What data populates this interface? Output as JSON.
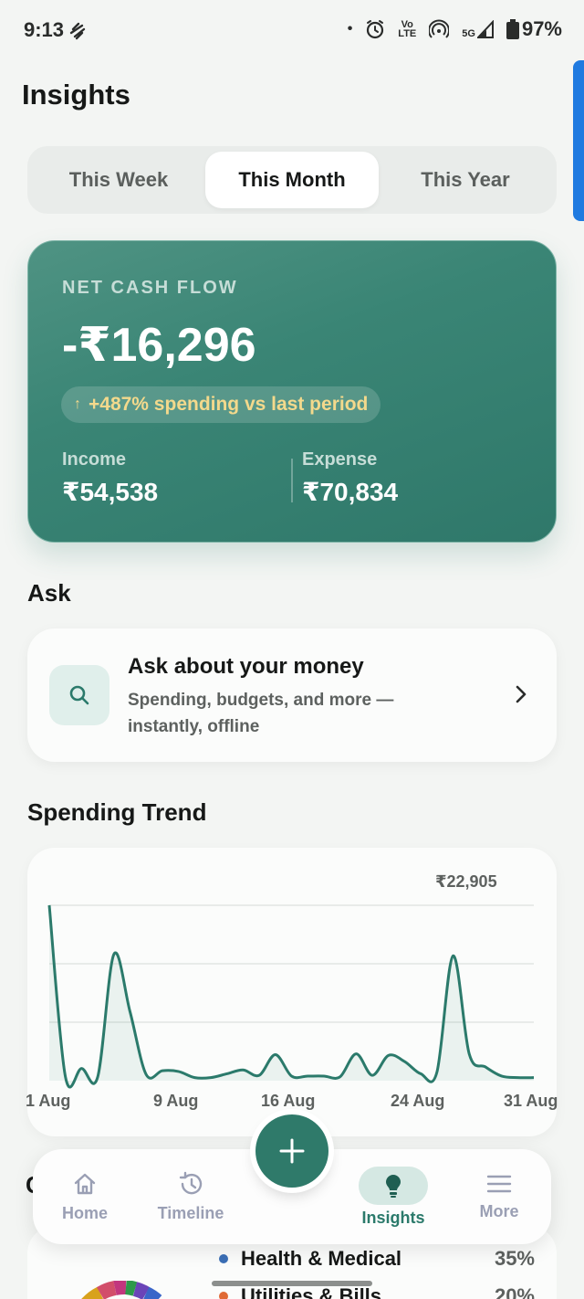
{
  "status_bar": {
    "time": "9:13",
    "lte_top": "Vo",
    "lte_bottom": "LTE",
    "network": "5G",
    "battery": "97%"
  },
  "page": {
    "title": "Insights"
  },
  "tabs": [
    {
      "label": "This Week",
      "active": false
    },
    {
      "label": "This Month",
      "active": true
    },
    {
      "label": "This Year",
      "active": false
    }
  ],
  "net_cash_flow": {
    "label": "NET CASH FLOW",
    "value": "-₹16,296",
    "change_arrow": "↑",
    "change_text": "+487% spending vs last period",
    "income_label": "Income",
    "income_value": "₹54,538",
    "expense_label": "Expense",
    "expense_value": "₹70,834",
    "accent_color": "#3a8575"
  },
  "ask": {
    "section_title": "Ask",
    "title": "Ask about your money",
    "description": "Spending, budgets, and more — instantly, offline",
    "icon": "search-icon"
  },
  "spending_trend": {
    "section_title": "Spending Trend",
    "max_label": "₹22,905",
    "x_labels": [
      "1 Aug",
      "9 Aug",
      "16 Aug",
      "24 Aug",
      "31 Aug"
    ]
  },
  "chart_data": {
    "type": "area",
    "x": [
      1,
      2,
      3,
      4,
      5,
      6,
      7,
      8,
      9,
      10,
      11,
      12,
      13,
      14,
      15,
      16,
      17,
      18,
      19,
      20,
      21,
      22,
      23,
      24,
      25,
      26,
      27,
      28,
      29,
      30,
      31
    ],
    "values": [
      22905,
      500,
      1600,
      500,
      16500,
      9000,
      800,
      1300,
      1200,
      400,
      400,
      900,
      1400,
      700,
      3400,
      600,
      600,
      600,
      500,
      3500,
      700,
      3300,
      2500,
      900,
      1100,
      16300,
      3500,
      1800,
      600,
      400,
      400
    ],
    "ylim": [
      0,
      22905
    ],
    "grid": true,
    "color": "#2b7a6b"
  },
  "breakdown": {
    "section_initial": "C",
    "items": [
      {
        "label": "Health & Medical",
        "pct": "35%",
        "color": "#3b6fb6"
      },
      {
        "label": "Utilities & Bills",
        "pct": "20%",
        "color": "#e06a35"
      }
    ]
  },
  "nav": {
    "items": [
      {
        "label": "Home",
        "icon": "home-icon"
      },
      {
        "label": "Timeline",
        "icon": "history-icon"
      },
      {
        "label": "Insights",
        "icon": "lightbulb-icon",
        "active": true
      },
      {
        "label": "More",
        "icon": "menu-icon"
      }
    ],
    "fab_icon": "plus-icon"
  }
}
